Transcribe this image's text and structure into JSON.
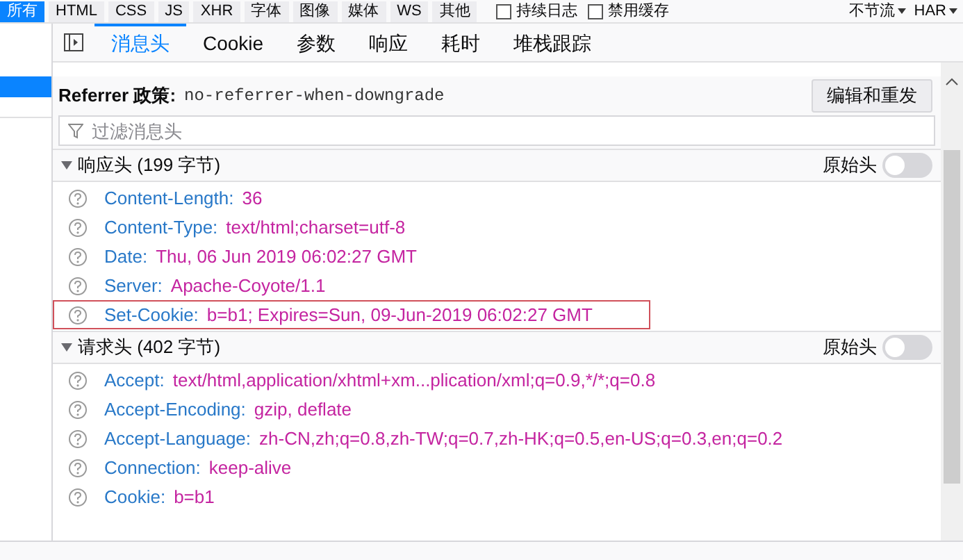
{
  "toolbar": {
    "filters": [
      {
        "label": "所有",
        "selected": true
      },
      {
        "label": "HTML",
        "selected": false
      },
      {
        "label": "CSS",
        "selected": false
      },
      {
        "label": "JS",
        "selected": false
      },
      {
        "label": "XHR",
        "selected": false
      },
      {
        "label": "字体",
        "selected": false
      },
      {
        "label": "图像",
        "selected": false
      },
      {
        "label": "媒体",
        "selected": false
      },
      {
        "label": "WS",
        "selected": false
      },
      {
        "label": "其他",
        "selected": false
      }
    ],
    "checkboxes": [
      {
        "label": "持续日志",
        "checked": false
      },
      {
        "label": "禁用缓存",
        "checked": false
      }
    ],
    "dropdowns": [
      "不节流",
      "HAR"
    ]
  },
  "tabs": [
    {
      "label": "消息头",
      "selected": true
    },
    {
      "label": "Cookie",
      "selected": false
    },
    {
      "label": "参数",
      "selected": false
    },
    {
      "label": "响应",
      "selected": false
    },
    {
      "label": "耗时",
      "selected": false
    },
    {
      "label": "堆栈跟踪",
      "selected": false
    }
  ],
  "referrer": {
    "label": "Referrer 政策:",
    "value": "no-referrer-when-downgrade"
  },
  "resend_button": "编辑和重发",
  "filter": {
    "placeholder": "过滤消息头"
  },
  "sections": [
    {
      "title": "响应头 (199 字节)",
      "expanded": true,
      "raw_label": "原始头",
      "raw_on": false,
      "headers": [
        {
          "name": "Content-Length:",
          "value": "36",
          "highlighted": false
        },
        {
          "name": "Content-Type:",
          "value": "text/html;charset=utf-8",
          "highlighted": false
        },
        {
          "name": "Date:",
          "value": "Thu, 06 Jun 2019 06:02:27 GMT",
          "highlighted": false
        },
        {
          "name": "Server:",
          "value": "Apache-Coyote/1.1",
          "highlighted": false
        },
        {
          "name": "Set-Cookie:",
          "value": "b=b1; Expires=Sun, 09-Jun-2019 06:02:27 GMT",
          "highlighted": true
        }
      ]
    },
    {
      "title": "请求头 (402 字节)",
      "expanded": true,
      "raw_label": "原始头",
      "raw_on": false,
      "headers": [
        {
          "name": "Accept:",
          "value": "text/html,application/xhtml+xm...plication/xml;q=0.9,*/*;q=0.8",
          "highlighted": false
        },
        {
          "name": "Accept-Encoding:",
          "value": "gzip, deflate",
          "highlighted": false
        },
        {
          "name": "Accept-Language:",
          "value": "zh-CN,zh;q=0.8,zh-TW;q=0.7,zh-HK;q=0.5,en-US;q=0.3,en;q=0.2",
          "highlighted": false
        },
        {
          "name": "Connection:",
          "value": "keep-alive",
          "highlighted": false
        },
        {
          "name": "Cookie:",
          "value": "b=b1",
          "highlighted": false
        }
      ]
    }
  ]
}
